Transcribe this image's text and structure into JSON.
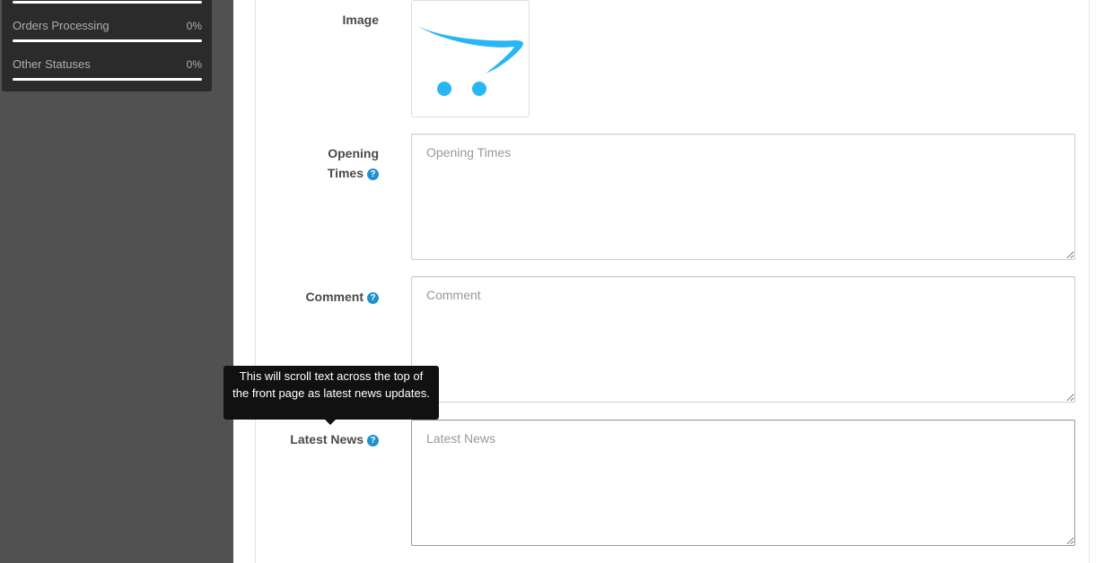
{
  "sidebar": {
    "stats": [
      {
        "label": "Orders Processing",
        "value": "0%",
        "progress": 0
      },
      {
        "label": "Other Statuses",
        "value": "0%",
        "progress": 0
      }
    ]
  },
  "form": {
    "image": {
      "label": "Image",
      "icon": "opencart-cart-logo"
    },
    "opening_times": {
      "label_line1": "Opening",
      "label_line2": "Times",
      "placeholder": "Opening Times",
      "value": "",
      "help": "?"
    },
    "comment": {
      "label": "Comment",
      "placeholder": "Comment",
      "value": "",
      "help": "?"
    },
    "latest_news": {
      "label": "Latest News",
      "placeholder": "Latest News",
      "value": "",
      "help": "?"
    }
  },
  "tooltip": {
    "text": "This will scroll text across the top of the front page as latest news updates."
  },
  "colors": {
    "sidebar_bg": "#515151",
    "stats_bg": "#2b2b2b",
    "help_icon": "#1e91cf",
    "logo_blue": "#29b6f6",
    "tooltip_bg": "#111111"
  }
}
